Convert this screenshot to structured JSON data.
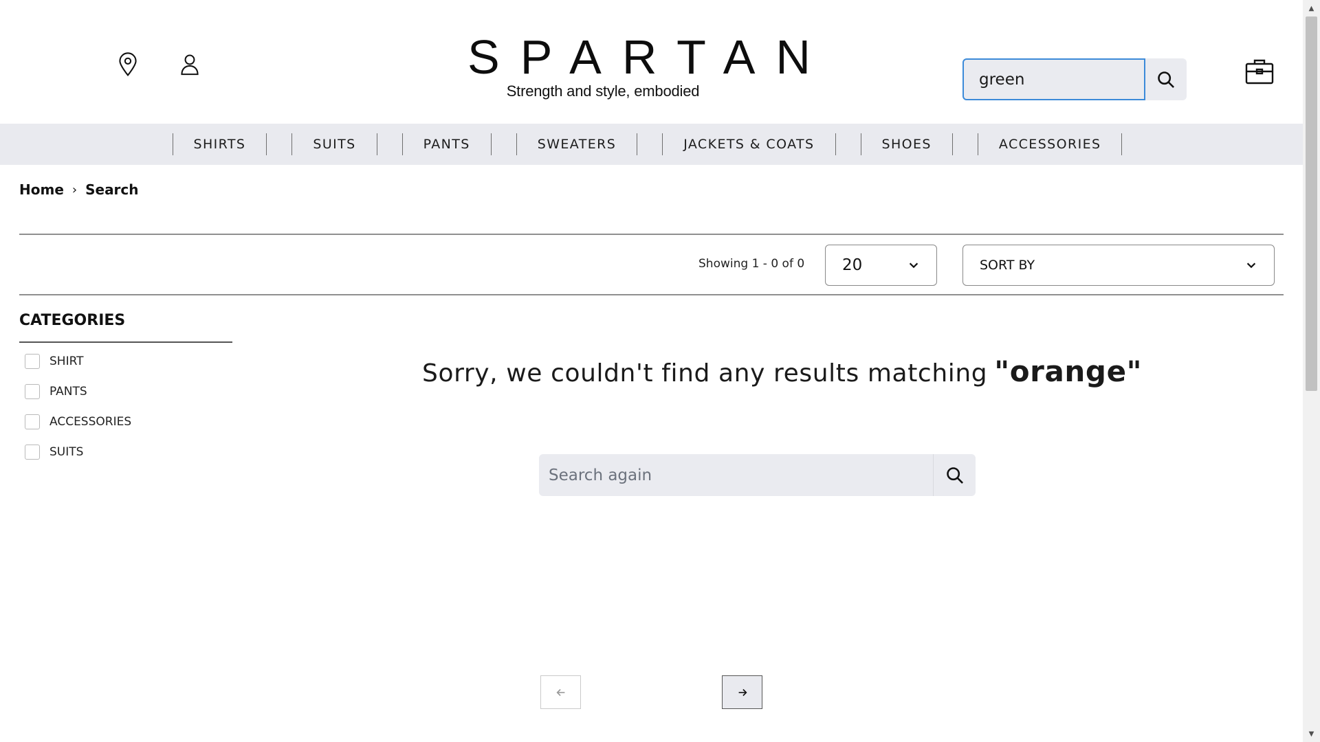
{
  "brand": {
    "name": "SPARTAN",
    "tagline": "Strength and style, embodied"
  },
  "header": {
    "search_value": "green",
    "icons": [
      "location-pin-icon",
      "user-icon",
      "search-icon",
      "briefcase-bag-icon"
    ]
  },
  "nav": {
    "items": [
      "SHIRTS",
      "SUITS",
      "PANTS",
      "SWEATERS",
      "JACKETS & COATS",
      "SHOES",
      "ACCESSORIES"
    ]
  },
  "breadcrumb": {
    "home": "Home",
    "separator": "›",
    "current": "Search"
  },
  "toolbar": {
    "showing": "Showing 1 - 0 of 0",
    "per_page": "20",
    "sort_label": "SORT BY"
  },
  "sidebar": {
    "title": "CATEGORIES",
    "categories": [
      "SHIRT",
      "PANTS",
      "ACCESSORIES",
      "SUITS"
    ]
  },
  "results": {
    "message": "Sorry, we couldn't find any results matching",
    "query": "\"orange\"",
    "search_again_placeholder": "Search again"
  },
  "colors": {
    "nav_background": "#e9eaef",
    "input_background": "#eaebf0",
    "focus_border": "#3b8ad9"
  }
}
